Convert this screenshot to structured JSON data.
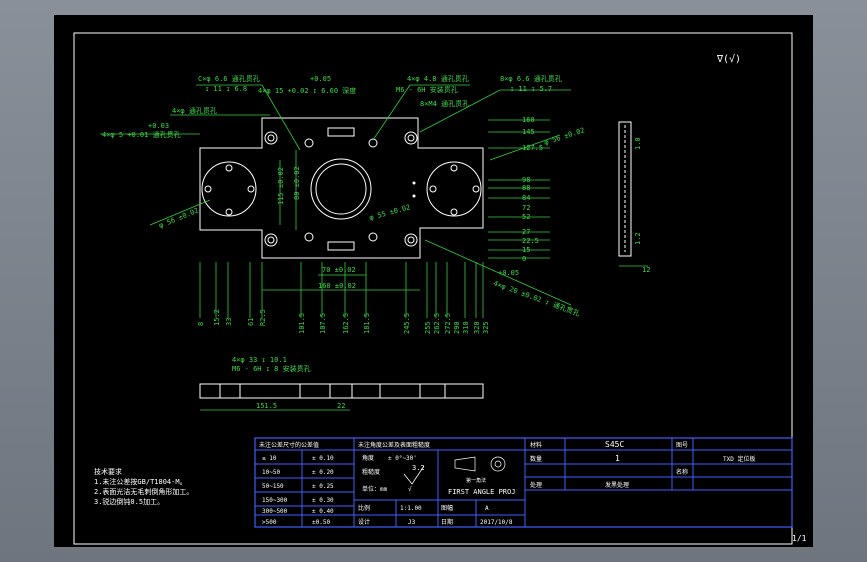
{
  "roughness": "∇(√)",
  "corner_sheet": "1/1",
  "plan_dims": {
    "top": [
      "C×φ 6.6 通孔贯孔",
      "↧ 11 ↧ 6.8",
      "4×φ 15 +0.02 ↧ 6.60 深度",
      "+0.05",
      "4×φ 4.8 通孔贯孔",
      "M6 - 6H 安装贯孔",
      "8×φ 6.6 通孔贯孔",
      "↧ 11 ↧ 5.7",
      "8×M4 通孔贯孔",
      "4×φ 通孔贯孔",
      "+0.03",
      "4×φ 5 +0.01 通孔贯孔"
    ],
    "right": [
      "160",
      "145",
      "127.5",
      "φ 56 ±0.02",
      "98",
      "88",
      "84",
      "72",
      "52",
      "27",
      "22.5",
      "15",
      "0"
    ],
    "bottom": [
      "8",
      "15.2",
      "33",
      "61",
      "R2.5",
      "101.5",
      "107.5",
      "162.5",
      "181.5",
      "245.5",
      "255",
      "262.5",
      "272.5",
      "290",
      "310",
      "320",
      "325"
    ],
    "inner": [
      "φ 56 ±0.02",
      "115 ±0.02",
      "80 ±0.02",
      "φ 55 ±0.02",
      "70 ±0.02",
      "160 ±0.02",
      "4×φ 20 ±0.02 ↧ 通孔贯孔",
      "+0.05"
    ],
    "side_h": "12",
    "side_v": [
      "1.0",
      "1.2"
    ]
  },
  "front_view": {
    "callouts": [
      "4×φ 33 ↧ 10.1",
      "M6 - 6H ↧ 8 安装贯孔"
    ],
    "dims": [
      "151.5",
      "22"
    ]
  },
  "notes": {
    "title": "技术要求",
    "lines": [
      "1.未注公差按GB/T1804-M。",
      "2.表面光洁无毛刺倒角形加工。",
      "3.锐边倒钝0.5加工。"
    ]
  },
  "title_block": {
    "tol_header": "未注公差尺寸的公差值",
    "tol_rows": [
      [
        "≤ 10",
        "± 0.10"
      ],
      [
        "10~50",
        "± 0.20"
      ],
      [
        "50~150",
        "± 0.25"
      ],
      [
        "150~300",
        "± 0.30"
      ],
      [
        "300~500",
        "± 0.40"
      ],
      [
        ">500",
        "±0.50"
      ]
    ],
    "proj_header": "未注角度公差及表面粗糙度",
    "angle_label": "角度",
    "angle_value": "± 0°~30'",
    "rough_label": "粗糙度",
    "rough_value": "3.2",
    "rough_sub": "√",
    "unit_label": "单位：mm",
    "proj_title": "第一角法",
    "proj_text": "FIRST ANGLE PROJ",
    "scale_label": "比例",
    "scale_value": "1:1.00",
    "format_label": "图幅",
    "format_value": "A",
    "draw_label": "设计",
    "draw_value": "J3",
    "date_label": "日期",
    "date_value": "2017/10/8",
    "material_label": "材料",
    "material_value": "S45C",
    "qty_label": "数量",
    "qty_value": "1",
    "treat_label": "处理",
    "treat_value": "发黑处理",
    "name_label": "图号",
    "part_name": "TXD 定位板",
    "drawing_no": "",
    "name_row_label": "名称",
    "company": ""
  }
}
